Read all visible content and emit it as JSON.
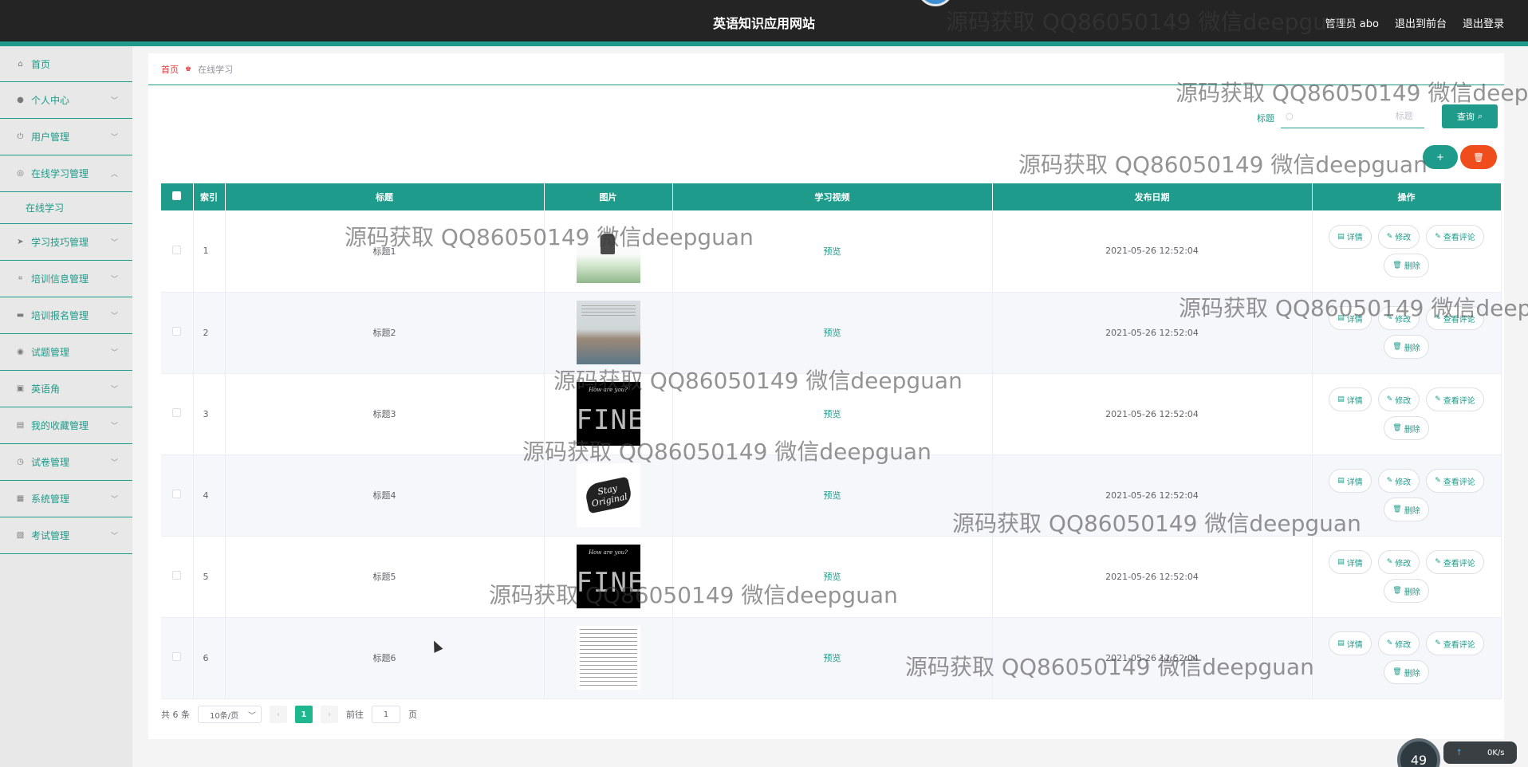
{
  "header": {
    "site_title": "英语知识应用网站",
    "user": "管理员 abo",
    "front_link": "退出到前台",
    "logout_link": "退出登录"
  },
  "sidebar": {
    "items": [
      {
        "label": "首页",
        "icon": "home-icon"
      },
      {
        "label": "个人中心",
        "icon": "user-icon"
      },
      {
        "label": "用户管理",
        "icon": "power-icon"
      },
      {
        "label": "在线学习管理",
        "icon": "compass-icon",
        "expanded": true,
        "children": [
          {
            "label": "在线学习"
          }
        ]
      },
      {
        "label": "学习技巧管理",
        "icon": "send-icon"
      },
      {
        "label": "培训信息管理",
        "icon": "crop-icon"
      },
      {
        "label": "培训报名管理",
        "icon": "comment-icon"
      },
      {
        "label": "试题管理",
        "icon": "target-icon"
      },
      {
        "label": "英语角",
        "icon": "briefcase-icon"
      },
      {
        "label": "我的收藏管理",
        "icon": "printer-icon"
      },
      {
        "label": "试卷管理",
        "icon": "clock-icon"
      },
      {
        "label": "系统管理",
        "icon": "clipboard-icon"
      },
      {
        "label": "考试管理",
        "icon": "checklist-icon"
      }
    ]
  },
  "breadcrumb": {
    "home": "首页",
    "current": "在线学习"
  },
  "search": {
    "label": "标题",
    "placeholder": "标题",
    "button": "查询"
  },
  "table": {
    "headers": [
      "索引",
      "标题",
      "图片",
      "学习视频",
      "发布日期",
      "操作"
    ],
    "preview_label": "预览",
    "ops": {
      "detail": "详情",
      "edit": "修改",
      "comments": "查看评论",
      "delete": "删除"
    },
    "rows": [
      {
        "index": "1",
        "title": "标题1",
        "date": "2021-05-26 12:52:04"
      },
      {
        "index": "2",
        "title": "标题2",
        "date": "2021-05-26 12:52:04"
      },
      {
        "index": "3",
        "title": "标题3",
        "date": "2021-05-26 12:52:04"
      },
      {
        "index": "4",
        "title": "标题4",
        "date": "2021-05-26 12:52:04"
      },
      {
        "index": "5",
        "title": "标题5",
        "date": "2021-05-26 12:52:04"
      },
      {
        "index": "6",
        "title": "标题6",
        "date": "2021-05-26 12:52:04"
      }
    ]
  },
  "images": {
    "img3_small": "How are you?",
    "img3_big": "FINE",
    "img5_small": "How are you?",
    "img5_big": "FINE",
    "img4_logo": "Stay Original"
  },
  "pagination": {
    "total": "共 6 条",
    "page_size": "10条/页",
    "current_page": "1",
    "goto_label": "前往",
    "goto_value": "1",
    "page_suffix": "页"
  },
  "watermark": "源码获取 QQ86050149 微信deepguan",
  "speed": {
    "gauge": "49",
    "rate": "0K/s"
  },
  "colors": {
    "accent": "#1e9b8a",
    "header_bg": "#242424",
    "danger": "#f04d1d"
  }
}
